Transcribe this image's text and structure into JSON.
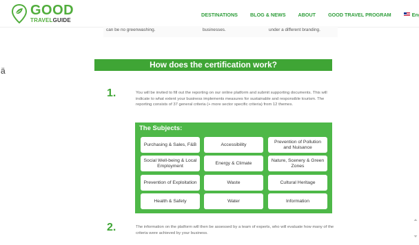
{
  "header": {
    "logo": {
      "line1": "GOOD",
      "line2_a": "TRAVEL",
      "line2_b": "GUIDE"
    },
    "nav": [
      "DESTINATIONS",
      "BLOG & NEWS",
      "ABOUT",
      "GOOD TRAVEL PROGRAM"
    ],
    "language": "English"
  },
  "snippets": [
    "can be no greenwashing.",
    "businesses.",
    "under a different branding."
  ],
  "stray_char": "ä",
  "banner": "How does the certification work?",
  "steps": [
    {
      "number": "1.",
      "text": "You will be invited to fill out the reporting on our online platform and submit supporting documents. This will indicate to what extent your business implements measures for sustainable and responsible tourism. The reporting consists of 37 general criteria (+ more sector specific criteria) from 12 themes."
    },
    {
      "number": "2.",
      "text": "The information on the platform will then be assessed by a team of experts, who will evaluate how many of the criteria were achieved by your business."
    }
  ],
  "subjects": {
    "title": "The Subjects:",
    "items": [
      "Purchasing & Sales, F&B",
      "Accessibility",
      "Prevention of Pollution and Nuisance",
      "Social Well-being & Local Employment",
      "Energy & Climate",
      "Nature, Scenery & Green Zones",
      "Prevention of Exploitation",
      "Waste",
      "Cultural Heritage",
      "Health & Safety",
      "Water",
      "Information"
    ]
  },
  "colors": {
    "brand_green": "#3fa535",
    "panel_green": "#4eb848"
  }
}
